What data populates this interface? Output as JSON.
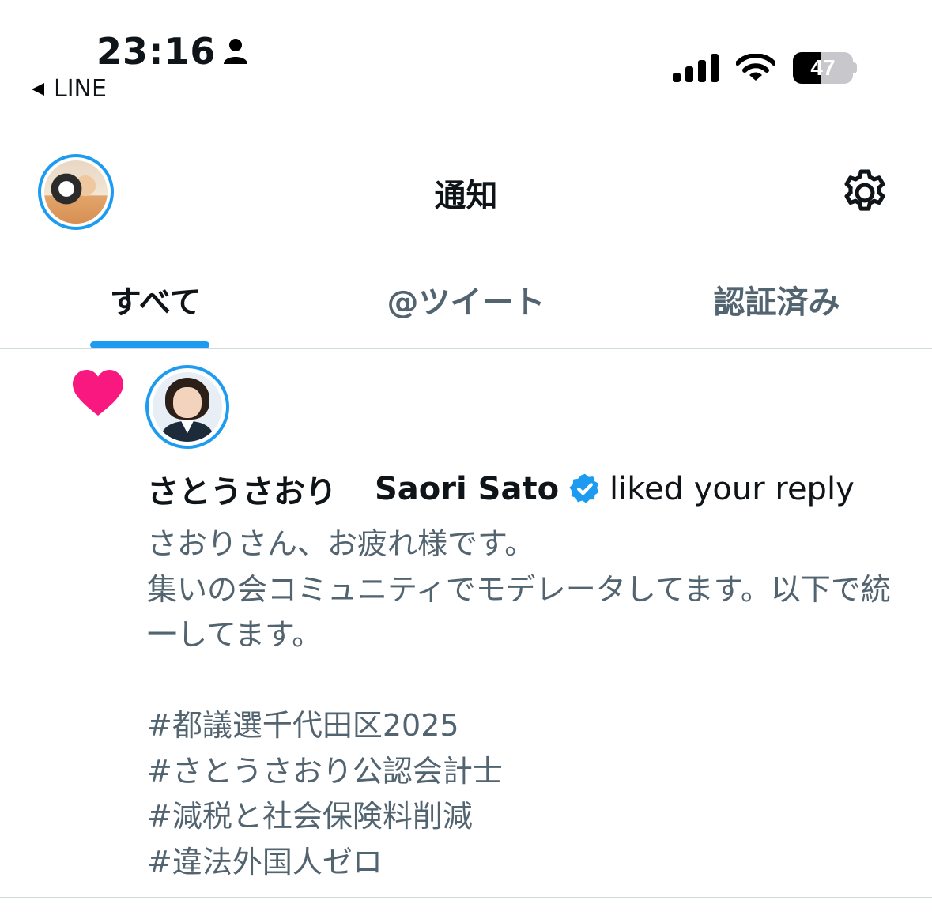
{
  "status_bar": {
    "time": "23:16",
    "back_app": "LINE",
    "battery": "47",
    "battery_level": 0.47,
    "icons": [
      "person-icon",
      "signal-icon",
      "wifi-icon",
      "battery-icon"
    ]
  },
  "header": {
    "title": "通知",
    "avatar": "profile-avatar",
    "settings_icon": "gear-icon"
  },
  "tabs": [
    {
      "label": "すべて",
      "active": true
    },
    {
      "label": "@ツイート",
      "active": false
    },
    {
      "label": "認証済み",
      "active": false
    }
  ],
  "notification": {
    "icon": "heart-icon",
    "user_name": "さとうさおり",
    "user_handle_name": "Saori Sato",
    "verified": true,
    "action": "liked your reply",
    "text": "さおりさん、お疲れ様です。\n集いの会コミュニティでモデレータしてます。以下で統一してます。\n\n#都議選千代田区2025\n#さとうさおり公認会計士\n#減税と社会保険料削減\n#違法外国人ゼロ"
  },
  "colors": {
    "accent": "#1d9bf0",
    "heart": "#f91880",
    "secondary_text": "#536471",
    "primary_text": "#0f1419"
  }
}
